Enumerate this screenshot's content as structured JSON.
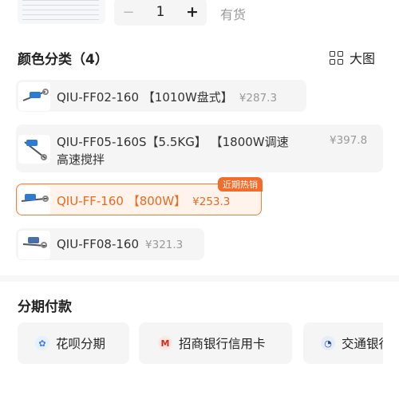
{
  "quantity": {
    "minus": "−",
    "value": "1",
    "plus": "+",
    "stock_status": "有货"
  },
  "color_section": {
    "title": "颜色分类（4）",
    "view_toggle": "大图",
    "options": [
      {
        "name": "QIU-FF02-160 【1010W盘式】",
        "price": "¥287.3",
        "selected": false
      },
      {
        "name": "QIU-FF05-160S【5.5KG】 【1800W调速",
        "name_line2": "高速搅拌",
        "price": "¥397.8",
        "selected": false
      },
      {
        "name": "QIU-FF-160 【800W】",
        "price": "¥253.3",
        "selected": true,
        "badge": "近期热销"
      },
      {
        "name": "QIU-FF08-160",
        "price": "¥321.3",
        "selected": false
      }
    ]
  },
  "installment": {
    "title": "分期付款",
    "options": [
      {
        "label": "花呗分期",
        "icon": "huabei-icon",
        "color": "#3b7cf5"
      },
      {
        "label": "招商银行信用卡",
        "icon": "cmb-icon",
        "color": "#d9261c"
      },
      {
        "label": "交通银行",
        "icon": "bocom-icon",
        "color": "#1f4e9a"
      }
    ]
  },
  "colors": {
    "accent": "#ec6a1e",
    "badge": "#f26d2a",
    "muted": "#999999"
  }
}
